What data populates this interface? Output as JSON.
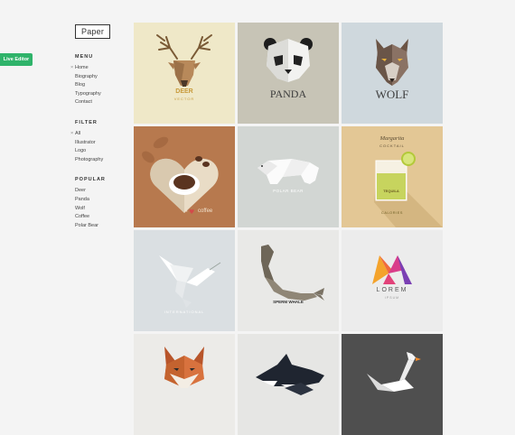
{
  "live_editor_label": "Live Editor",
  "logo": "Paper",
  "sidebar": {
    "menu": {
      "title": "MENU",
      "items": [
        "Home",
        "Biography",
        "Blog",
        "Typography",
        "Contact"
      ]
    },
    "filter": {
      "title": "FILTER",
      "items": [
        "All",
        "Illustrator",
        "Logo",
        "Photography"
      ]
    },
    "popular": {
      "title": "POPULAR",
      "items": [
        "Deer",
        "Panda",
        "Wolf",
        "Coffee",
        "Polar Bear"
      ]
    }
  },
  "tiles": {
    "deer": {
      "title": "DEER",
      "subtitle": "VECTOR",
      "bg": "#efe8c8"
    },
    "panda": {
      "title": "PANDA",
      "bg": "#c7c4b6"
    },
    "wolf": {
      "title": "WOLF",
      "bg": "#cfd8dd"
    },
    "coffee": {
      "caption_left": "I",
      "caption_right": "coffee",
      "bg": "#b7794e"
    },
    "polar_bear": {
      "title": "POLAR BEAR",
      "bg": "#d2d6d3"
    },
    "cocktail": {
      "title": "Margarita",
      "subtitle": "COCKTAIL",
      "glass_text": "TEQUILA",
      "footer": "CALORIES",
      "bg": "#e3c795"
    },
    "dove": {
      "caption": "INTERNATIONAL",
      "bg": "#dadfe2"
    },
    "whale": {
      "title": "SPERM WHALE",
      "bg": "#e9e9e7"
    },
    "lorem": {
      "title": "LOREM",
      "subtitle": "IPSUM",
      "bg": "#ececec"
    },
    "fox": {
      "bg": "#ecebe8"
    },
    "orca": {
      "bg": "#e6e6e4"
    },
    "swan": {
      "bg": "#4f4f4f"
    }
  }
}
